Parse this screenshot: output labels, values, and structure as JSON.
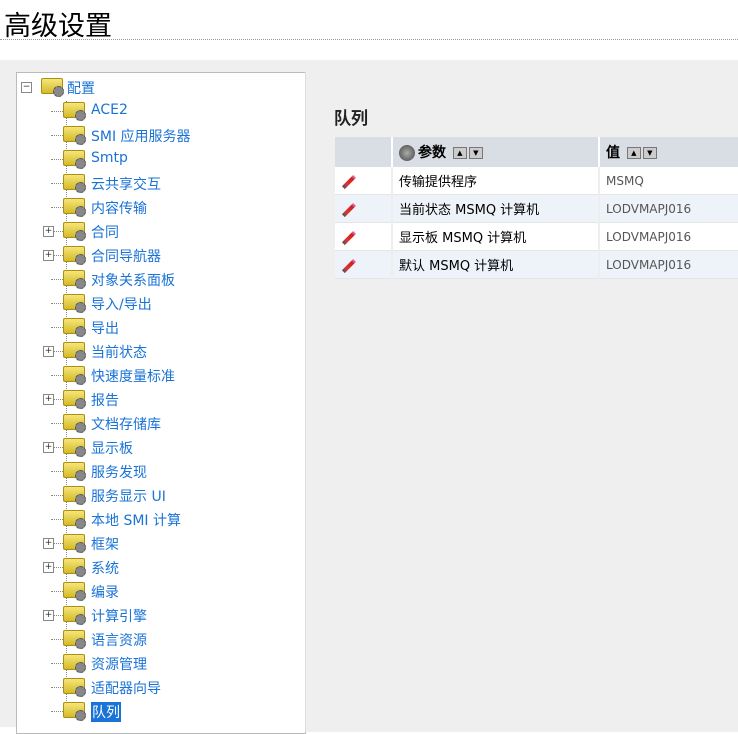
{
  "title": "高级设置",
  "tree": {
    "root": "配置",
    "items": [
      {
        "label": "ACE2",
        "expandable": false
      },
      {
        "label": "SMI 应用服务器",
        "expandable": false
      },
      {
        "label": "Smtp",
        "expandable": false
      },
      {
        "label": "云共享交互",
        "expandable": false
      },
      {
        "label": "内容传输",
        "expandable": false
      },
      {
        "label": "合同",
        "expandable": true
      },
      {
        "label": "合同导航器",
        "expandable": true
      },
      {
        "label": "对象关系面板",
        "expandable": false
      },
      {
        "label": "导入/导出",
        "expandable": false
      },
      {
        "label": "导出",
        "expandable": false
      },
      {
        "label": "当前状态",
        "expandable": true
      },
      {
        "label": "快速度量标准",
        "expandable": false
      },
      {
        "label": "报告",
        "expandable": true
      },
      {
        "label": "文档存储库",
        "expandable": false
      },
      {
        "label": "显示板",
        "expandable": true
      },
      {
        "label": "服务发现",
        "expandable": false
      },
      {
        "label": "服务显示 UI",
        "expandable": false
      },
      {
        "label": "本地 SMI 计算",
        "expandable": false
      },
      {
        "label": "框架",
        "expandable": true
      },
      {
        "label": "系统",
        "expandable": true
      },
      {
        "label": "编录",
        "expandable": false
      },
      {
        "label": "计算引擎",
        "expandable": true
      },
      {
        "label": "语言资源",
        "expandable": false
      },
      {
        "label": "资源管理",
        "expandable": false
      },
      {
        "label": "适配器向导",
        "expandable": false
      },
      {
        "label": "队列",
        "expandable": false,
        "selected": true
      }
    ]
  },
  "panel": {
    "title": "队列",
    "columns": {
      "param": "参数",
      "value": "值"
    },
    "rows": [
      {
        "param": "传输提供程序",
        "value": "MSMQ"
      },
      {
        "param": "当前状态 MSMQ 计算机",
        "value": "LODVMAPJ016"
      },
      {
        "param": "显示板 MSMQ 计算机",
        "value": "LODVMAPJ016"
      },
      {
        "param": "默认 MSMQ 计算机",
        "value": "LODVMAPJ016"
      }
    ]
  }
}
